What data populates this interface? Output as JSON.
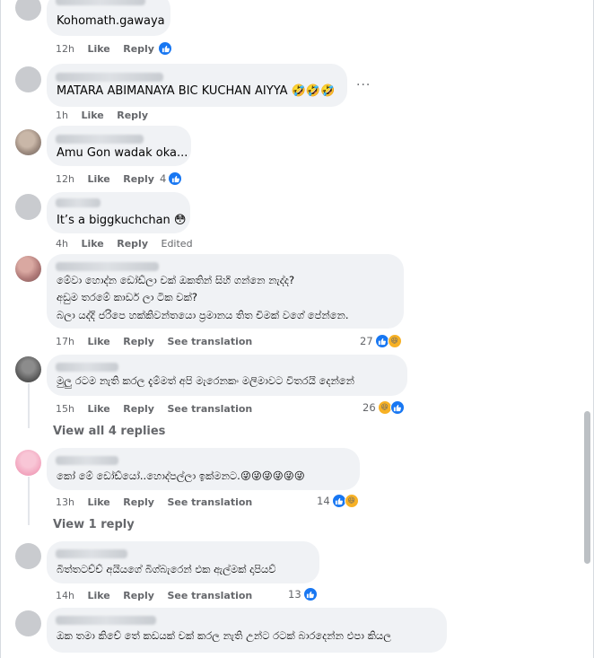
{
  "comments": [
    {
      "text": "Kohomath.gawaya",
      "time": "12h",
      "like": "Like",
      "reply": "Reply",
      "reactions": {
        "count": "",
        "types": [
          "like"
        ]
      }
    },
    {
      "text": "MATARA ABIMANAYA BIC KUCHAN AIYYA 🤣🤣🤣",
      "time": "1h",
      "like": "Like",
      "reply": "Reply",
      "more": "···"
    },
    {
      "text": "Amu Gon wadak oka...",
      "time": "12h",
      "like": "Like",
      "reply": "Reply",
      "reactions": {
        "count": "4",
        "types": [
          "like"
        ]
      }
    },
    {
      "text": "It’s a biggkuchchan 😳",
      "time": "4h",
      "like": "Like",
      "reply": "Reply",
      "edited": "Edited"
    },
    {
      "lines": [
        "මේවා හොද්න ඩෝඩ්ලා චක් ඔකතින් සිහි ගන්නෙ නැද්ද?",
        "අඩුම තරමේ කාඩර් ලා ටික චක්?",
        "බලා යද්දි ජරිපෙ හක්කිවන්තයො ප්‍රමානය තිත චිමක් වගේ පේන්නෙ."
      ],
      "time": "17h",
      "like": "Like",
      "reply": "Reply",
      "translate": "See translation",
      "reactions": {
        "count": "27",
        "types": [
          "like",
          "haha"
        ]
      }
    },
    {
      "text": "මුලු රටම නැති කරල දැම්මත් අපි මැරෙනකං මලිමාවට විතරයි දෙන්නේ",
      "time": "15h",
      "like": "Like",
      "reply": "Reply",
      "translate": "See translation",
      "reactions": {
        "count": "26",
        "types": [
          "haha",
          "like"
        ]
      },
      "view_replies": "View all 4 replies"
    },
    {
      "text": "කෝ මේ ඩෝඩ්යෝ..හොද්පල්ලා ඉක්මනට.😜😜😜😜😜😜",
      "time": "13h",
      "like": "Like",
      "reply": "Reply",
      "translate": "See translation",
      "reactions": {
        "count": "14",
        "types": [
          "like",
          "haha"
        ]
      },
      "view_replies": "View 1 reply"
    },
    {
      "text": "බිත්තටච්ච් අයියගේ බිග්බැරෙන් එක ඇල්මක් දාපියව්",
      "time": "14h",
      "like": "Like",
      "reply": "Reply",
      "translate": "See translation",
      "reactions": {
        "count": "13",
        "types": [
          "like"
        ]
      }
    },
    {
      "text": "ඔක තමා කිචේ තේ කඩයක් චක් කරල නැති උන්ට රටක් බාරදෙන්න එපා කියල"
    }
  ],
  "colors": {
    "like": "#1877f2",
    "haha": "#f7b125",
    "bubble": "#f0f2f5",
    "meta": "#65676b"
  },
  "icons": {
    "like": "like-icon",
    "haha": "haha-icon"
  }
}
